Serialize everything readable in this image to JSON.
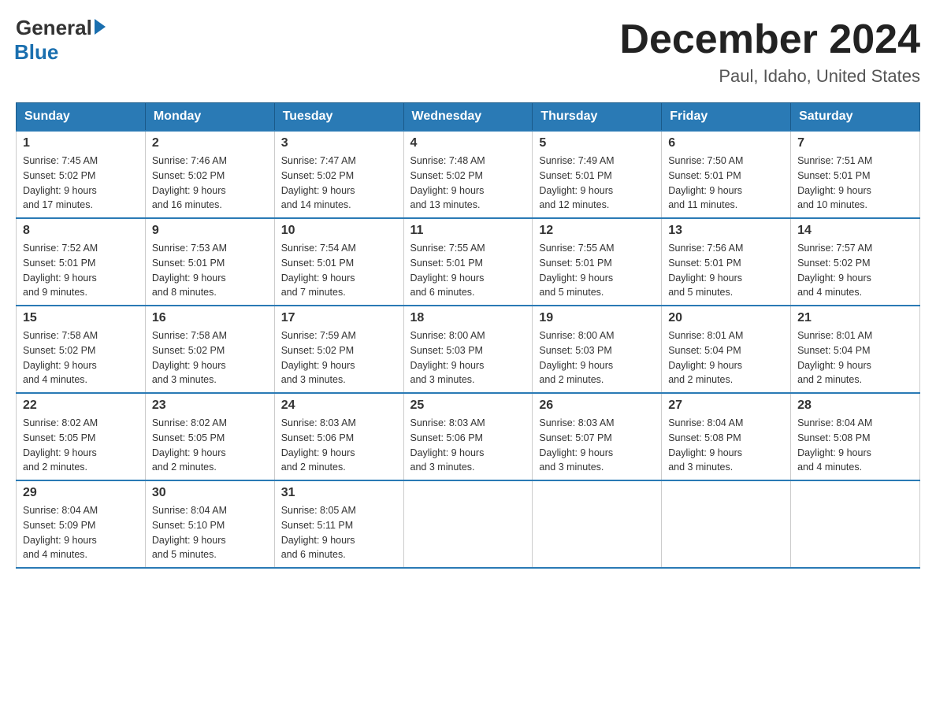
{
  "logo": {
    "general": "General",
    "blue": "Blue"
  },
  "title": "December 2024",
  "location": "Paul, Idaho, United States",
  "days_header": [
    "Sunday",
    "Monday",
    "Tuesday",
    "Wednesday",
    "Thursday",
    "Friday",
    "Saturday"
  ],
  "weeks": [
    [
      {
        "day": "1",
        "sunrise": "7:45 AM",
        "sunset": "5:02 PM",
        "daylight": "9 hours and 17 minutes."
      },
      {
        "day": "2",
        "sunrise": "7:46 AM",
        "sunset": "5:02 PM",
        "daylight": "9 hours and 16 minutes."
      },
      {
        "day": "3",
        "sunrise": "7:47 AM",
        "sunset": "5:02 PM",
        "daylight": "9 hours and 14 minutes."
      },
      {
        "day": "4",
        "sunrise": "7:48 AM",
        "sunset": "5:02 PM",
        "daylight": "9 hours and 13 minutes."
      },
      {
        "day": "5",
        "sunrise": "7:49 AM",
        "sunset": "5:01 PM",
        "daylight": "9 hours and 12 minutes."
      },
      {
        "day": "6",
        "sunrise": "7:50 AM",
        "sunset": "5:01 PM",
        "daylight": "9 hours and 11 minutes."
      },
      {
        "day": "7",
        "sunrise": "7:51 AM",
        "sunset": "5:01 PM",
        "daylight": "9 hours and 10 minutes."
      }
    ],
    [
      {
        "day": "8",
        "sunrise": "7:52 AM",
        "sunset": "5:01 PM",
        "daylight": "9 hours and 9 minutes."
      },
      {
        "day": "9",
        "sunrise": "7:53 AM",
        "sunset": "5:01 PM",
        "daylight": "9 hours and 8 minutes."
      },
      {
        "day": "10",
        "sunrise": "7:54 AM",
        "sunset": "5:01 PM",
        "daylight": "9 hours and 7 minutes."
      },
      {
        "day": "11",
        "sunrise": "7:55 AM",
        "sunset": "5:01 PM",
        "daylight": "9 hours and 6 minutes."
      },
      {
        "day": "12",
        "sunrise": "7:55 AM",
        "sunset": "5:01 PM",
        "daylight": "9 hours and 5 minutes."
      },
      {
        "day": "13",
        "sunrise": "7:56 AM",
        "sunset": "5:01 PM",
        "daylight": "9 hours and 5 minutes."
      },
      {
        "day": "14",
        "sunrise": "7:57 AM",
        "sunset": "5:02 PM",
        "daylight": "9 hours and 4 minutes."
      }
    ],
    [
      {
        "day": "15",
        "sunrise": "7:58 AM",
        "sunset": "5:02 PM",
        "daylight": "9 hours and 4 minutes."
      },
      {
        "day": "16",
        "sunrise": "7:58 AM",
        "sunset": "5:02 PM",
        "daylight": "9 hours and 3 minutes."
      },
      {
        "day": "17",
        "sunrise": "7:59 AM",
        "sunset": "5:02 PM",
        "daylight": "9 hours and 3 minutes."
      },
      {
        "day": "18",
        "sunrise": "8:00 AM",
        "sunset": "5:03 PM",
        "daylight": "9 hours and 3 minutes."
      },
      {
        "day": "19",
        "sunrise": "8:00 AM",
        "sunset": "5:03 PM",
        "daylight": "9 hours and 2 minutes."
      },
      {
        "day": "20",
        "sunrise": "8:01 AM",
        "sunset": "5:04 PM",
        "daylight": "9 hours and 2 minutes."
      },
      {
        "day": "21",
        "sunrise": "8:01 AM",
        "sunset": "5:04 PM",
        "daylight": "9 hours and 2 minutes."
      }
    ],
    [
      {
        "day": "22",
        "sunrise": "8:02 AM",
        "sunset": "5:05 PM",
        "daylight": "9 hours and 2 minutes."
      },
      {
        "day": "23",
        "sunrise": "8:02 AM",
        "sunset": "5:05 PM",
        "daylight": "9 hours and 2 minutes."
      },
      {
        "day": "24",
        "sunrise": "8:03 AM",
        "sunset": "5:06 PM",
        "daylight": "9 hours and 2 minutes."
      },
      {
        "day": "25",
        "sunrise": "8:03 AM",
        "sunset": "5:06 PM",
        "daylight": "9 hours and 3 minutes."
      },
      {
        "day": "26",
        "sunrise": "8:03 AM",
        "sunset": "5:07 PM",
        "daylight": "9 hours and 3 minutes."
      },
      {
        "day": "27",
        "sunrise": "8:04 AM",
        "sunset": "5:08 PM",
        "daylight": "9 hours and 3 minutes."
      },
      {
        "day": "28",
        "sunrise": "8:04 AM",
        "sunset": "5:08 PM",
        "daylight": "9 hours and 4 minutes."
      }
    ],
    [
      {
        "day": "29",
        "sunrise": "8:04 AM",
        "sunset": "5:09 PM",
        "daylight": "9 hours and 4 minutes."
      },
      {
        "day": "30",
        "sunrise": "8:04 AM",
        "sunset": "5:10 PM",
        "daylight": "9 hours and 5 minutes."
      },
      {
        "day": "31",
        "sunrise": "8:05 AM",
        "sunset": "5:11 PM",
        "daylight": "9 hours and 6 minutes."
      },
      null,
      null,
      null,
      null
    ]
  ]
}
